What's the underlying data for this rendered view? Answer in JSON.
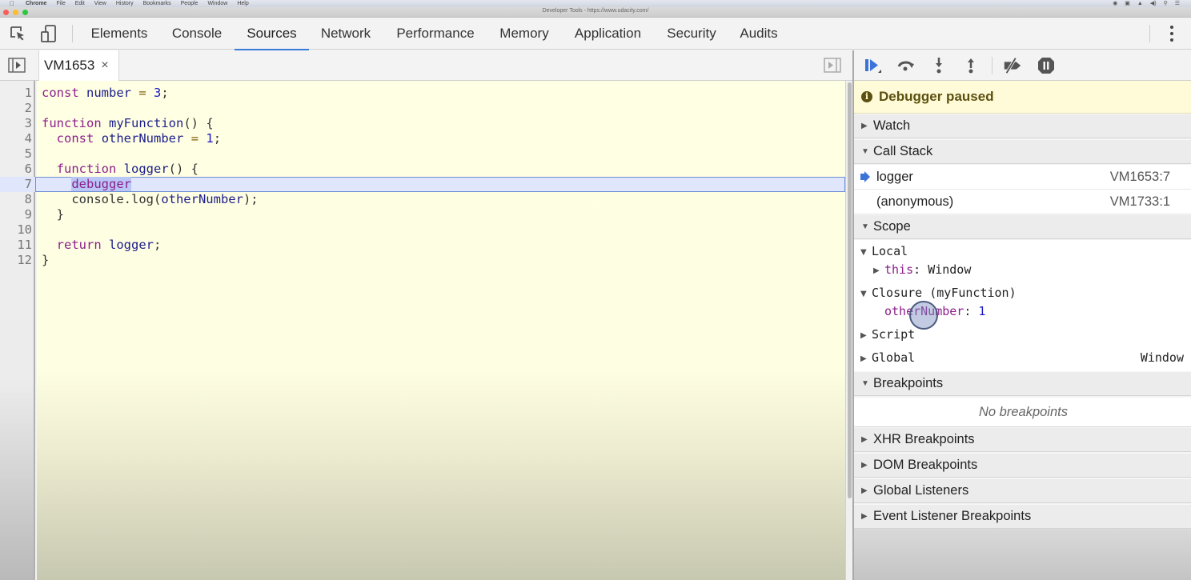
{
  "os_menubar": {
    "app": "Chrome",
    "items": [
      "File",
      "Edit",
      "View",
      "History",
      "Bookmarks",
      "People",
      "Window",
      "Help"
    ]
  },
  "window": {
    "title": "Developer Tools - https://www.udacity.com/",
    "traffic_light_colors": [
      "#fc5c57",
      "#fdbb2d",
      "#2ac840"
    ]
  },
  "toolbar": {
    "icons": [
      "inspect-element-icon",
      "device-toolbar-icon"
    ],
    "tabs": [
      {
        "label": "Elements",
        "active": false
      },
      {
        "label": "Console",
        "active": false
      },
      {
        "label": "Sources",
        "active": true
      },
      {
        "label": "Network",
        "active": false
      },
      {
        "label": "Performance",
        "active": false
      },
      {
        "label": "Memory",
        "active": false
      },
      {
        "label": "Application",
        "active": false
      },
      {
        "label": "Security",
        "active": false
      },
      {
        "label": "Audits",
        "active": false
      }
    ],
    "accent": "#3879d9"
  },
  "file_tabs": {
    "open": [
      {
        "name": "VM1653",
        "close_glyph": "×"
      }
    ]
  },
  "editor": {
    "current_line": 7,
    "lines": [
      {
        "n": "1",
        "text": "const number = 3;"
      },
      {
        "n": "2",
        "text": ""
      },
      {
        "n": "3",
        "text": "function myFunction() {"
      },
      {
        "n": "4",
        "text": "  const otherNumber = 1;"
      },
      {
        "n": "5",
        "text": ""
      },
      {
        "n": "6",
        "text": "  function logger() {"
      },
      {
        "n": "7",
        "text": "    debugger"
      },
      {
        "n": "8",
        "text": "    console.log(otherNumber);"
      },
      {
        "n": "9",
        "text": "  }"
      },
      {
        "n": "10",
        "text": ""
      },
      {
        "n": "11",
        "text": "  return logger;"
      },
      {
        "n": "12",
        "text": "}"
      }
    ]
  },
  "debugger": {
    "controls": [
      "resume-icon",
      "step-over-icon",
      "step-into-icon",
      "step-out-icon",
      "deactivate-breakpoints-icon",
      "pause-on-exceptions-icon"
    ],
    "status": "Debugger paused",
    "sections": {
      "watch": "Watch",
      "call_stack": "Call Stack",
      "scope": "Scope",
      "breakpoints": "Breakpoints",
      "xhr": "XHR Breakpoints",
      "dom": "DOM Breakpoints",
      "global_listeners": "Global Listeners",
      "event_listeners": "Event Listener Breakpoints"
    },
    "call_stack": [
      {
        "fn": "logger",
        "location": "VM1653:7",
        "current": true
      },
      {
        "fn": "(anonymous)",
        "location": "VM1733:1",
        "current": false
      }
    ],
    "scope": {
      "local": "Local",
      "this_name": "this",
      "this_sep": ": ",
      "this_value": "Window",
      "closure": "Closure (myFunction)",
      "closure_var": "otherNumber",
      "closure_sep": ": ",
      "closure_value": "1",
      "script": "Script",
      "global": "Global",
      "global_value": "Window"
    },
    "no_breakpoints": "No breakpoints"
  }
}
